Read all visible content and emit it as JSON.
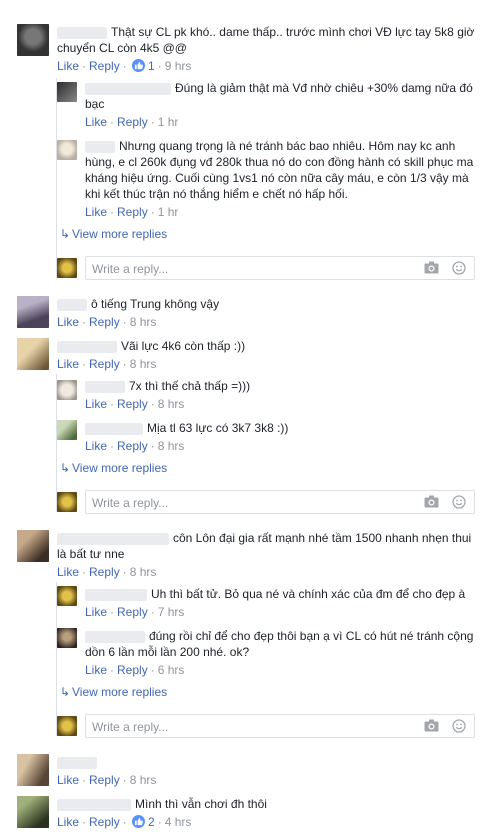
{
  "labels": {
    "like": "Like",
    "reply": "Reply",
    "view_more": "View more replies",
    "write_reply": "Write a reply...",
    "dot": "·"
  },
  "colors": {
    "link": "#4267b2",
    "meta": "#90949c",
    "like_badge": "#5890ff"
  },
  "threads": [
    {
      "comment": {
        "text": "Thật sự CL pk khó.. dame thấp.. trước mình chơi VĐ lực tay 5k8 giờ chuyển CL còn 4k5 @@",
        "reactions": "1",
        "time": "9 hrs"
      },
      "replies": [
        {
          "text": "Đúng là giảm thật mà Vđ nhờ chiêu +30% damg nữa đó bạc",
          "time": "1 hr"
        },
        {
          "text": "Nhưng quang trọng là né tránh bác bao nhiêu. Hôm nay kc anh hùng, e cl 260k đụng vđ 280k thua nó do con đồng hành có skill phục ma kháng hiệu ứng. Cuối cùng 1vs1 nó còn nữa cây máu, e còn 1/3 vậy mà khi kết thúc trận nó thắng hiểm e chết nó hấp hối.",
          "time": "1 hr"
        }
      ]
    },
    {
      "comment": {
        "text": "ô tiếng Trung không vậy",
        "time": "8 hrs"
      }
    },
    {
      "comment": {
        "text": "Vãi lực 4k6 còn thấp :))",
        "time": "8 hrs"
      },
      "replies": [
        {
          "text": "7x thì thế chả thấp =)))",
          "time": "8 hrs"
        },
        {
          "text": "Mịa tl 63 lực có 3k7 3k8 :))",
          "time": "8 hrs"
        }
      ]
    },
    {
      "comment": {
        "text": "côn Lôn đại gia rất mạnh nhé tầm 1500 nhanh nhẹn thui là bất tư nne",
        "time": "8 hrs"
      },
      "replies": [
        {
          "text": "Uh thì bất tử. Bỏ qua né và chính xác của đm để cho đẹp à",
          "time": "7 hrs"
        },
        {
          "text": "đúng rồi chỉ để cho đẹp thôi bạn ạ vì CL có hút né tránh cộng dồn 6 lần mỗi lần 200 nhé. ok?",
          "time": "6 hrs"
        }
      ]
    },
    {
      "comment": {
        "time": "8 hrs"
      }
    },
    {
      "comment": {
        "text": "Mình thì vẫn chơi đh thôi",
        "reactions": "2",
        "time": "4 hrs"
      }
    }
  ]
}
